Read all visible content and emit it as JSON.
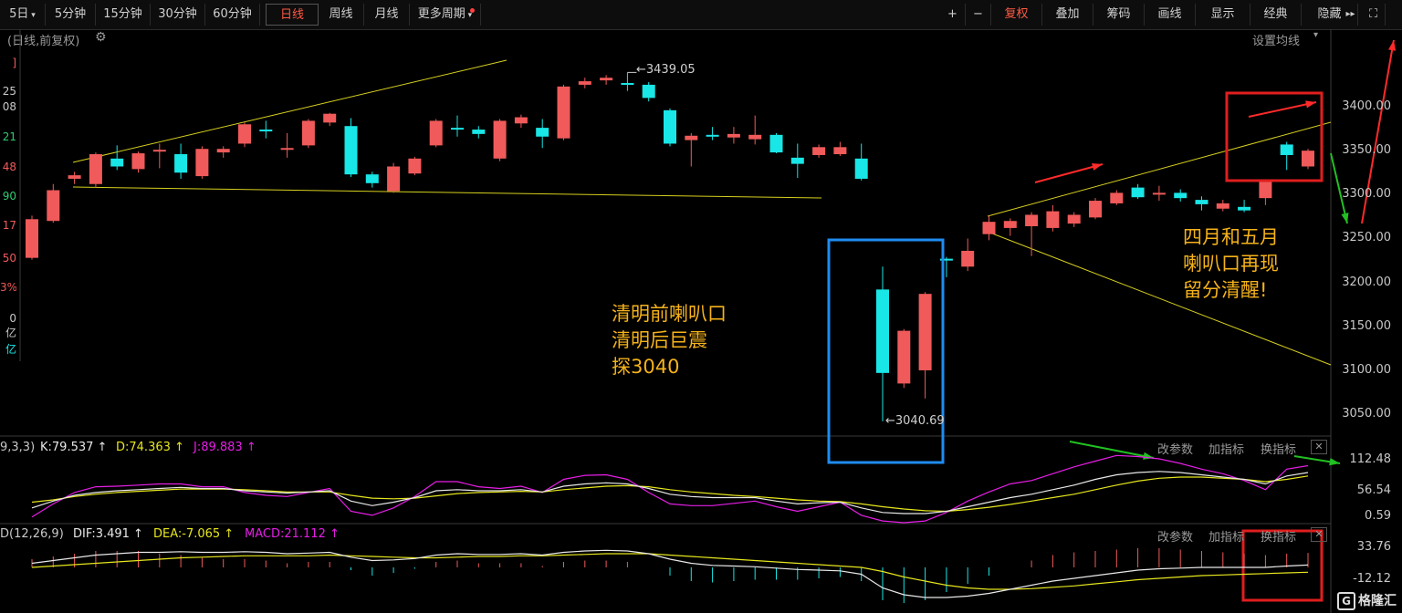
{
  "toolbar": {
    "left": [
      "5日",
      "5分钟",
      "15分钟",
      "30分钟",
      "60分钟",
      "日线",
      "周线",
      "月线",
      "更多周期"
    ],
    "active": "日线",
    "right": [
      "+",
      "−",
      "复权",
      "叠加",
      "筹码",
      "画线",
      "显示",
      "经典",
      "隐藏"
    ],
    "icon_names": [
      "arrows-icon",
      "fullscreen-icon"
    ]
  },
  "header": {
    "title": "(日线,前复权)",
    "settings": "设置均线"
  },
  "left_strip": [
    "]",
    "25",
    "08",
    "21",
    "48",
    "90",
    "17",
    "50",
    "3%",
    "0亿",
    "亿"
  ],
  "y_axis": [
    "3400.00",
    "3350.00",
    "3300.00",
    "3250.00",
    "3200.00",
    "3150.00",
    "3100.00",
    "3050.00"
  ],
  "annotations": {
    "high_label": "←3439.05",
    "low_label": "←3040.69",
    "note_left": [
      "清明前喇叭口",
      "清明后巨震",
      "探3040"
    ],
    "note_right": [
      "四月和五月",
      "喇叭口再现",
      "留分清醒!"
    ]
  },
  "kdj": {
    "title": "9,3,3)",
    "k": "K:79.537 ↑",
    "d": "D:74.363 ↑",
    "j": "J:89.883 ↑",
    "axis": [
      "112.48",
      "56.54",
      "0.59"
    ],
    "buttons": [
      "改参数",
      "加指标",
      "换指标"
    ]
  },
  "macd": {
    "title": "D(12,26,9)",
    "dif": "DIF:3.491 ↑",
    "dea": "DEA:-7.065 ↑",
    "macd": "MACD:21.112 ↑",
    "axis": [
      "33.76",
      "-12.12"
    ],
    "buttons": [
      "改参数",
      "加指标",
      "换指标"
    ]
  },
  "logo": "格隆汇",
  "colors": {
    "up": "#f05a5a",
    "down": "#19e6e6",
    "trend": "#d6d01e",
    "blue_box": "#1e8cf0",
    "red_box": "#e01e1e",
    "note": "#f5b21b"
  },
  "chart_data": {
    "type": "candlestick",
    "ylim": [
      3020,
      3460
    ],
    "high_mark": 3439.05,
    "low_mark": 3040.69,
    "candles": [
      {
        "o": 3228,
        "c": 3272,
        "h": 3276,
        "l": 3226
      },
      {
        "o": 3270,
        "c": 3305,
        "h": 3312,
        "l": 3268
      },
      {
        "o": 3318,
        "c": 3322,
        "h": 3326,
        "l": 3312
      },
      {
        "o": 3312,
        "c": 3346,
        "h": 3348,
        "l": 3308
      },
      {
        "o": 3341,
        "c": 3332,
        "h": 3356,
        "l": 3328
      },
      {
        "o": 3329,
        "c": 3347,
        "h": 3349,
        "l": 3325
      },
      {
        "o": 3350,
        "c": 3351,
        "h": 3358,
        "l": 3330
      },
      {
        "o": 3346,
        "c": 3325,
        "h": 3358,
        "l": 3318
      },
      {
        "o": 3321,
        "c": 3352,
        "h": 3355,
        "l": 3318
      },
      {
        "o": 3348,
        "c": 3352,
        "h": 3355,
        "l": 3342
      },
      {
        "o": 3358,
        "c": 3380,
        "h": 3382,
        "l": 3354
      },
      {
        "o": 3374,
        "c": 3373,
        "h": 3384,
        "l": 3364
      },
      {
        "o": 3352,
        "c": 3353,
        "h": 3370,
        "l": 3342
      },
      {
        "o": 3356,
        "c": 3384,
        "h": 3386,
        "l": 3353
      },
      {
        "o": 3382,
        "c": 3392,
        "h": 3393,
        "l": 3378
      },
      {
        "o": 3378,
        "c": 3323,
        "h": 3387,
        "l": 3320
      },
      {
        "o": 3323,
        "c": 3313,
        "h": 3326,
        "l": 3308
      },
      {
        "o": 3304,
        "c": 3332,
        "h": 3336,
        "l": 3302
      },
      {
        "o": 3324,
        "c": 3341,
        "h": 3343,
        "l": 3322
      },
      {
        "o": 3356,
        "c": 3384,
        "h": 3386,
        "l": 3354
      },
      {
        "o": 3376,
        "c": 3376,
        "h": 3390,
        "l": 3366
      },
      {
        "o": 3374,
        "c": 3369,
        "h": 3378,
        "l": 3364
      },
      {
        "o": 3341,
        "c": 3384,
        "h": 3386,
        "l": 3338
      },
      {
        "o": 3381,
        "c": 3388,
        "h": 3391,
        "l": 3376
      },
      {
        "o": 3376,
        "c": 3366,
        "h": 3386,
        "l": 3353
      },
      {
        "o": 3364,
        "c": 3423,
        "h": 3425,
        "l": 3362
      },
      {
        "o": 3425,
        "c": 3429,
        "h": 3433,
        "l": 3421
      },
      {
        "o": 3430,
        "c": 3433,
        "h": 3436,
        "l": 3425
      },
      {
        "o": 3427,
        "c": 3426,
        "h": 3439,
        "l": 3418
      },
      {
        "o": 3425,
        "c": 3410,
        "h": 3428,
        "l": 3406
      },
      {
        "o": 3396,
        "c": 3358,
        "h": 3398,
        "l": 3355
      },
      {
        "o": 3362,
        "c": 3367,
        "h": 3370,
        "l": 3332
      },
      {
        "o": 3368,
        "c": 3368,
        "h": 3377,
        "l": 3362
      },
      {
        "o": 3365,
        "c": 3369,
        "h": 3377,
        "l": 3358
      },
      {
        "o": 3363,
        "c": 3368,
        "h": 3390,
        "l": 3357
      },
      {
        "o": 3368,
        "c": 3348,
        "h": 3370,
        "l": 3347
      },
      {
        "o": 3342,
        "c": 3335,
        "h": 3358,
        "l": 3319
      },
      {
        "o": 3345,
        "c": 3354,
        "h": 3357,
        "l": 3342
      },
      {
        "o": 3346,
        "c": 3354,
        "h": 3360,
        "l": 3344
      },
      {
        "o": 3341,
        "c": 3318,
        "h": 3358,
        "l": 3316
      },
      {
        "o": 3192,
        "c": 3097,
        "h": 3218,
        "l": 3042
      },
      {
        "o": 3085,
        "c": 3145,
        "h": 3147,
        "l": 3080
      },
      {
        "o": 3100,
        "c": 3187,
        "h": 3189,
        "l": 3068
      },
      {
        "o": 3227,
        "c": 3227,
        "h": 3229,
        "l": 3206
      },
      {
        "o": 3218,
        "c": 3236,
        "h": 3250,
        "l": 3213
      },
      {
        "o": 3255,
        "c": 3269,
        "h": 3276,
        "l": 3248
      },
      {
        "o": 3262,
        "c": 3270,
        "h": 3273,
        "l": 3253
      },
      {
        "o": 3264,
        "c": 3277,
        "h": 3280,
        "l": 3230
      },
      {
        "o": 3262,
        "c": 3281,
        "h": 3288,
        "l": 3258
      },
      {
        "o": 3267,
        "c": 3277,
        "h": 3280,
        "l": 3263
      },
      {
        "o": 3274,
        "c": 3293,
        "h": 3296,
        "l": 3272
      },
      {
        "o": 3290,
        "c": 3302,
        "h": 3305,
        "l": 3288
      },
      {
        "o": 3308,
        "c": 3297,
        "h": 3312,
        "l": 3295
      },
      {
        "o": 3300,
        "c": 3302,
        "h": 3310,
        "l": 3293
      },
      {
        "o": 3302,
        "c": 3296,
        "h": 3306,
        "l": 3292
      },
      {
        "o": 3294,
        "c": 3289,
        "h": 3298,
        "l": 3282
      },
      {
        "o": 3284,
        "c": 3290,
        "h": 3294,
        "l": 3281
      },
      {
        "o": 3286,
        "c": 3282,
        "h": 3294,
        "l": 3280
      },
      {
        "o": 3296,
        "c": 3315,
        "h": 3317,
        "l": 3288
      },
      {
        "o": 3357,
        "c": 3345,
        "h": 3360,
        "l": 3328
      },
      {
        "o": 3332,
        "c": 3350,
        "h": 3352,
        "l": 3329
      }
    ],
    "kdj_k": [
      18,
      30,
      40,
      45,
      48,
      50,
      52,
      54,
      52,
      52,
      48,
      46,
      44,
      46,
      48,
      30,
      22,
      28,
      36,
      48,
      50,
      48,
      48,
      50,
      46,
      56,
      60,
      62,
      60,
      52,
      42,
      38,
      36,
      36,
      36,
      30,
      25,
      27,
      28,
      18,
      10,
      8,
      8,
      12,
      20,
      28,
      36,
      42,
      50,
      58,
      68,
      76,
      80,
      82,
      80,
      76,
      72,
      68,
      60,
      74,
      80
    ],
    "kdj_d": [
      28,
      32,
      38,
      42,
      45,
      47,
      49,
      51,
      51,
      51,
      50,
      48,
      46,
      46,
      46,
      40,
      35,
      34,
      35,
      39,
      43,
      45,
      46,
      47,
      46,
      50,
      53,
      56,
      57,
      55,
      50,
      46,
      43,
      40,
      38,
      35,
      32,
      30,
      29,
      25,
      20,
      16,
      13,
      12,
      15,
      19,
      24,
      30,
      36,
      42,
      50,
      58,
      65,
      70,
      72,
      72,
      70,
      68,
      64,
      68,
      74
    ],
    "kdj_j": [
      2,
      25,
      45,
      55,
      56,
      58,
      60,
      60,
      55,
      55,
      45,
      40,
      38,
      45,
      52,
      12,
      5,
      18,
      38,
      64,
      64,
      55,
      52,
      56,
      45,
      68,
      75,
      76,
      68,
      45,
      25,
      22,
      22,
      26,
      30,
      20,
      12,
      20,
      28,
      5,
      -5,
      -8,
      -5,
      10,
      30,
      46,
      60,
      66,
      78,
      90,
      100,
      110,
      108,
      104,
      96,
      86,
      78,
      66,
      50,
      86,
      92
    ],
    "macd_dif": [
      6,
      10,
      14,
      18,
      20,
      22,
      22,
      23,
      22,
      22,
      23,
      22,
      20,
      21,
      22,
      15,
      10,
      11,
      13,
      18,
      20,
      19,
      19,
      20,
      18,
      22,
      24,
      25,
      24,
      20,
      12,
      6,
      3,
      2,
      1,
      -1,
      -3,
      -4,
      -5,
      -10,
      -30,
      -40,
      -44,
      -44,
      -42,
      -38,
      -32,
      -26,
      -20,
      -16,
      -12,
      -8,
      -4,
      -2,
      -1,
      0,
      0,
      0,
      0,
      2,
      3.5
    ],
    "macd_dea": [
      0,
      2,
      4,
      6,
      8,
      10,
      12,
      14,
      15,
      16,
      17,
      17,
      17,
      17,
      18,
      17,
      16,
      15,
      14,
      14,
      15,
      16,
      16,
      17,
      17,
      18,
      19,
      20,
      20,
      20,
      18,
      16,
      14,
      12,
      10,
      8,
      6,
      4,
      2,
      0,
      -6,
      -14,
      -20,
      -26,
      -30,
      -32,
      -32,
      -31,
      -29,
      -27,
      -24,
      -21,
      -18,
      -16,
      -14,
      -12,
      -11,
      -10,
      -9,
      -8,
      -7.065
    ]
  }
}
